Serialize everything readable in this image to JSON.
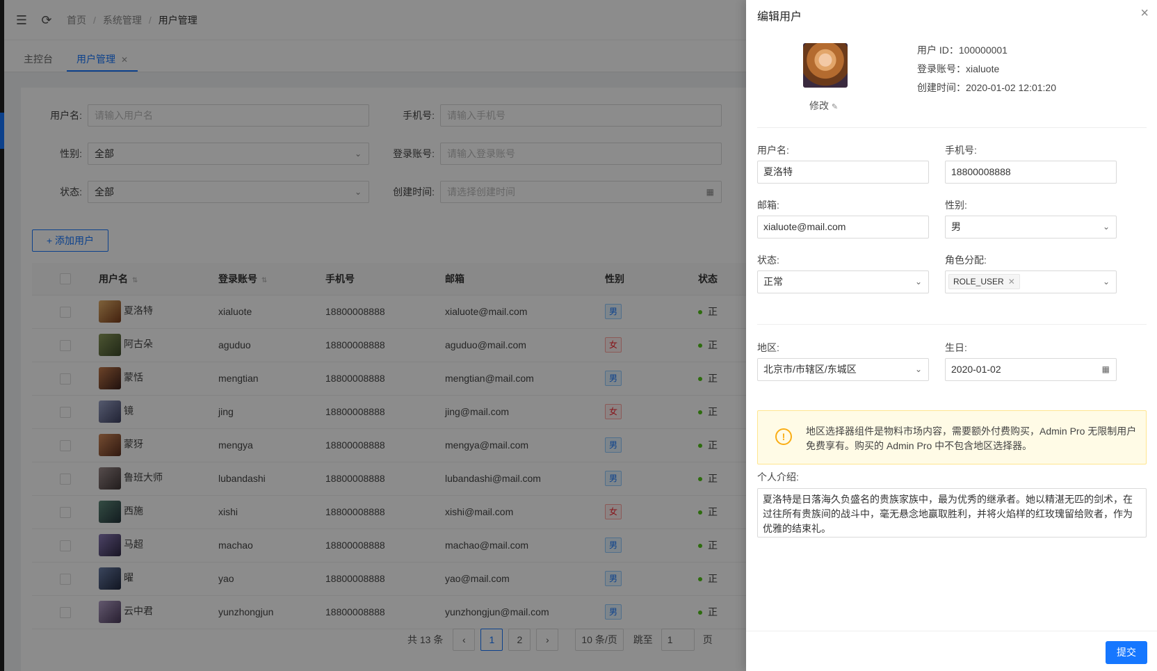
{
  "breadcrumb": [
    "首页",
    "系统管理",
    "用户管理"
  ],
  "tabs": [
    {
      "label": "主控台"
    },
    {
      "label": "用户管理"
    }
  ],
  "filters": {
    "username_label": "用户名:",
    "username_ph": "请输入用户名",
    "phone_label": "手机号:",
    "phone_ph": "请输入手机号",
    "gender_label": "性别:",
    "gender_value": "全部",
    "account_label": "登录账号:",
    "account_ph": "请输入登录账号",
    "status_label": "状态:",
    "status_value": "全部",
    "created_label": "创建时间:",
    "created_ph": "请选择创建时间"
  },
  "add_user_label": "+ 添加用户",
  "table": {
    "headers": [
      "用户名",
      "登录账号",
      "手机号",
      "邮箱",
      "性别",
      "状态"
    ],
    "rows": [
      {
        "name": "夏洛特",
        "account": "xialuote",
        "phone": "18800008888",
        "email": "xialuote@mail.com",
        "gender": "男",
        "status": "正"
      },
      {
        "name": "阿古朵",
        "account": "aguduo",
        "phone": "18800008888",
        "email": "aguduo@mail.com",
        "gender": "女",
        "status": "正"
      },
      {
        "name": "蒙恬",
        "account": "mengtian",
        "phone": "18800008888",
        "email": "mengtian@mail.com",
        "gender": "男",
        "status": "正"
      },
      {
        "name": "镜",
        "account": "jing",
        "phone": "18800008888",
        "email": "jing@mail.com",
        "gender": "女",
        "status": "正"
      },
      {
        "name": "蒙犽",
        "account": "mengya",
        "phone": "18800008888",
        "email": "mengya@mail.com",
        "gender": "男",
        "status": "正"
      },
      {
        "name": "鲁班大师",
        "account": "lubandashi",
        "phone": "18800008888",
        "email": "lubandashi@mail.com",
        "gender": "男",
        "status": "正"
      },
      {
        "name": "西施",
        "account": "xishi",
        "phone": "18800008888",
        "email": "xishi@mail.com",
        "gender": "女",
        "status": "正"
      },
      {
        "name": "马超",
        "account": "machao",
        "phone": "18800008888",
        "email": "machao@mail.com",
        "gender": "男",
        "status": "正"
      },
      {
        "name": "曜",
        "account": "yao",
        "phone": "18800008888",
        "email": "yao@mail.com",
        "gender": "男",
        "status": "正"
      },
      {
        "name": "云中君",
        "account": "yunzhongjun",
        "phone": "18800008888",
        "email": "yunzhongjun@mail.com",
        "gender": "男",
        "status": "正"
      }
    ]
  },
  "pager": {
    "total": "共 13 条",
    "prev": "‹",
    "pages": [
      "1",
      "2"
    ],
    "next": "›",
    "size": "10 条/页",
    "jump_label": "跳至",
    "jump_value": "1",
    "page_unit": "页"
  },
  "drawer": {
    "title": "编辑用户",
    "close": "×",
    "edit_avatar": "修改",
    "user_id": "用户 ID：100000001",
    "login": "登录账号：xialuote",
    "created": "创建时间：2020-01-02 12:01:20",
    "username_label": "用户名:",
    "username_value": "夏洛特",
    "phone_label": "手机号:",
    "phone_value": "18800008888",
    "email_label": "邮箱:",
    "email_value": "xialuote@mail.com",
    "gender_label": "性别:",
    "gender_value": "男",
    "status_label": "状态:",
    "status_value": "正常",
    "role_label": "角色分配:",
    "role_chip": "ROLE_USER",
    "region_label": "地区:",
    "region_value": "北京市/市辖区/东城区",
    "birthday_label": "生日:",
    "birthday_value": "2020-01-02",
    "warning": "地区选择器组件是物料市场内容，需要额外付费购买，Admin Pro 无限制用户免费享有。购买的 Admin Pro 中不包含地区选择器。",
    "bio_label": "个人介绍:",
    "bio_value": "夏洛特是日落海久负盛名的贵族家族中，最为优秀的继承者。她以精湛无匹的剑术，在过往所有贵族间的战斗中，毫无悬念地赢取胜利，并将火焰样的红玫瑰留给败者，作为优雅的结束礼。",
    "submit": "提交"
  },
  "colors": {
    "primary": "#1677ff",
    "success": "#52c41a",
    "warning": "#faad14",
    "danger": "#f5222d"
  }
}
